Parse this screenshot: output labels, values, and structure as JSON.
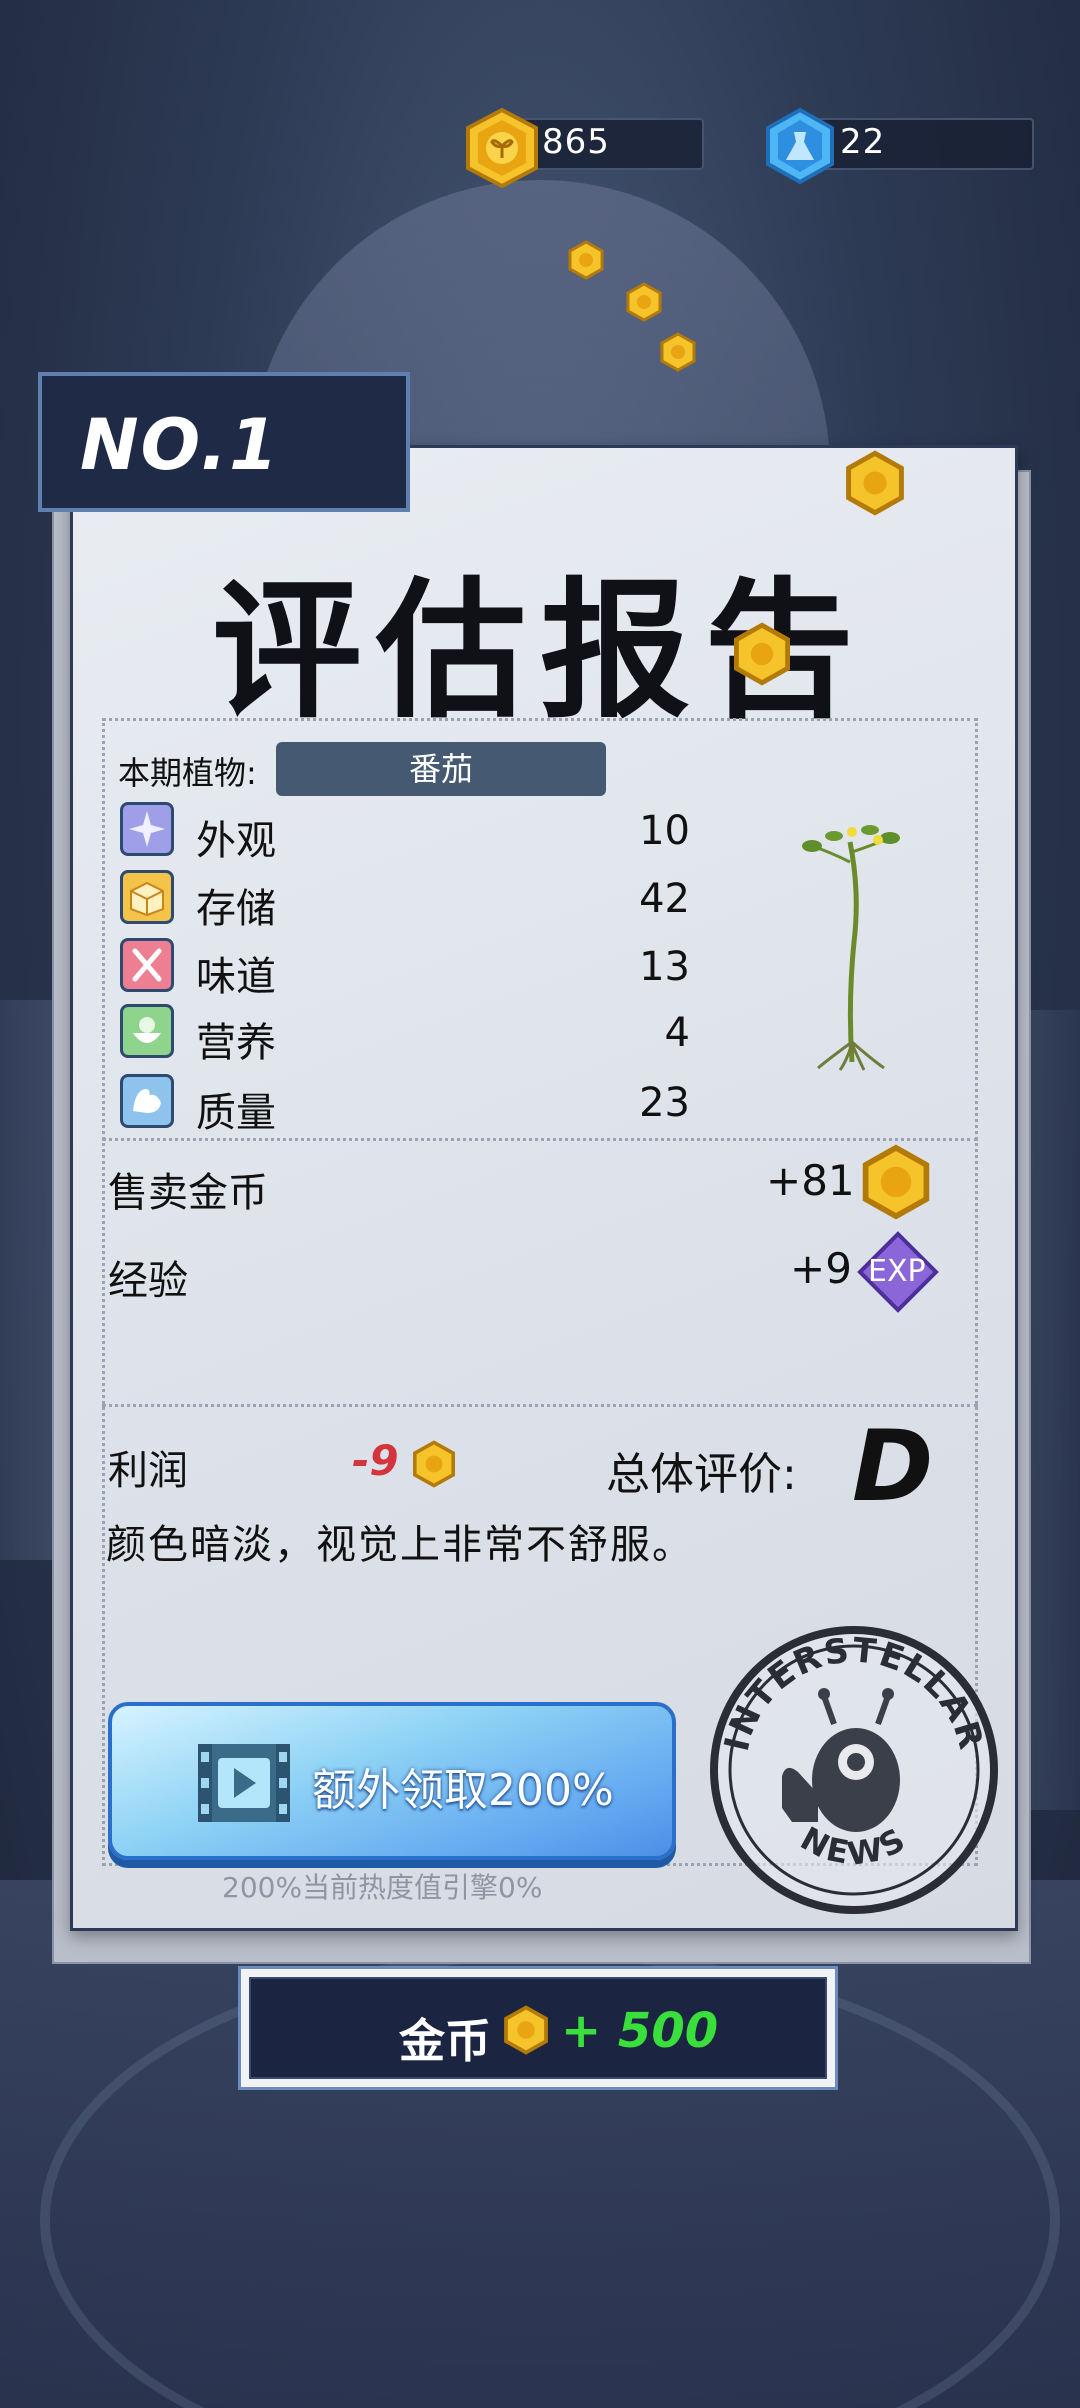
{
  "currency": {
    "coins": "865",
    "gems": "22"
  },
  "report": {
    "rank": "NO.1",
    "title": "评估报告",
    "plant_label": "本期植物:",
    "plant_name": "番茄",
    "stats": [
      {
        "label": "外观",
        "value": "10",
        "icon": "sparkle-icon"
      },
      {
        "label": "存储",
        "value": "42",
        "icon": "box-icon"
      },
      {
        "label": "味道",
        "value": "13",
        "icon": "utensils-icon"
      },
      {
        "label": "营养",
        "value": "4",
        "icon": "nutrition-icon"
      },
      {
        "label": "质量",
        "value": "23",
        "icon": "muscle-icon"
      }
    ],
    "sell_label": "售卖金币",
    "sell_value": "+81",
    "exp_label": "经验",
    "exp_value": "+9",
    "exp_badge": "EXP",
    "profit_label": "利润",
    "profit_value": "-9",
    "rating_label": "总体评价:",
    "rating": "D",
    "comment": "颜色暗淡，视觉上非常不舒服。",
    "bonus_button": "额外领取200%",
    "heat_note": "200%当前热度值引擎0%",
    "stamp_top": "INTERSTELLAR",
    "stamp_bottom": "NEWS"
  },
  "reward": {
    "label": "金币",
    "value": "+ 500"
  },
  "colors": {
    "coin": "#f2b21b",
    "gem": "#3ea6ee",
    "profit_negative": "#d2353c",
    "reward_green": "#39e03c"
  }
}
